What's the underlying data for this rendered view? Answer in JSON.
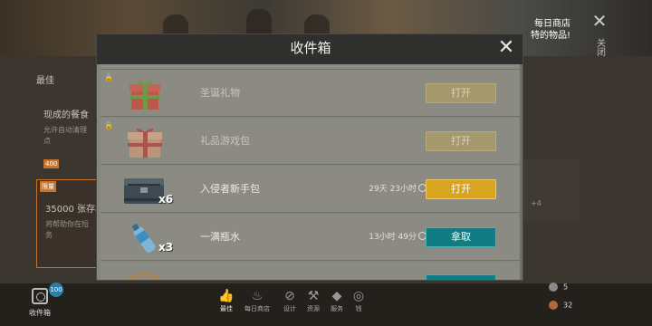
{
  "background": {
    "daily_shop_line1": "每日商店",
    "daily_shop_line2": "特的物品!",
    "close_label": "关闭",
    "left_panel": {
      "tab_best": "最佳",
      "offer_title": "现成的餐食",
      "offer_desc_line1": "允许自动清理",
      "offer_desc_line2": "点",
      "offer_price": "400",
      "card_tag": "限量",
      "card_title": "35000 张存档",
      "card_desc_line1": "将帮助你在短",
      "card_desc_line2": "务"
    },
    "plus_badge": "+4",
    "resources": [
      {
        "value": "5",
        "color": "#8a8a8a"
      },
      {
        "value": "32",
        "color": "#b06a3a"
      }
    ]
  },
  "bottom_nav": {
    "mailbox_label": "收件箱",
    "mailbox_badge": "100",
    "items": [
      {
        "label": "最佳",
        "icon": "thumbs-up-icon",
        "glyph": "👍",
        "active": true
      },
      {
        "label": "每日商店",
        "icon": "flame-icon",
        "glyph": "♨",
        "active": false
      },
      {
        "label": "设计",
        "icon": "compass-icon",
        "glyph": "⊘",
        "active": false
      },
      {
        "label": "资源",
        "icon": "tools-icon",
        "glyph": "⚒",
        "active": false
      },
      {
        "label": "服务",
        "icon": "ticket-icon",
        "glyph": "◆",
        "active": false
      },
      {
        "label": "钱",
        "icon": "coin-icon",
        "glyph": "◎",
        "active": false
      }
    ]
  },
  "modal": {
    "title": "收件箱",
    "close_icon": "close-icon",
    "items": [
      {
        "name": "圣诞礼物",
        "icon": "christmas-gift-icon",
        "locked": true,
        "qty": "",
        "timer": "",
        "button": "打开",
        "button_type": "open-disabled"
      },
      {
        "name": "礼品游戏包",
        "icon": "gift-box-icon",
        "locked": true,
        "qty": "",
        "timer": "",
        "button": "打开",
        "button_type": "open-disabled"
      },
      {
        "name": "入侵者新手包",
        "icon": "metal-crate-icon",
        "locked": false,
        "qty": "x6",
        "timer": "29天 23小时",
        "button": "打开",
        "button_type": "open"
      },
      {
        "name": "一满瓶水",
        "icon": "water-bottle-icon",
        "locked": false,
        "qty": "x3",
        "timer": "13小时 49分",
        "button": "拿取",
        "button_type": "take"
      }
    ]
  },
  "colors": {
    "open_button": "#d9a520",
    "take_button": "#127c82",
    "modal_header": "#2f302d",
    "modal_body": "#85867e"
  }
}
